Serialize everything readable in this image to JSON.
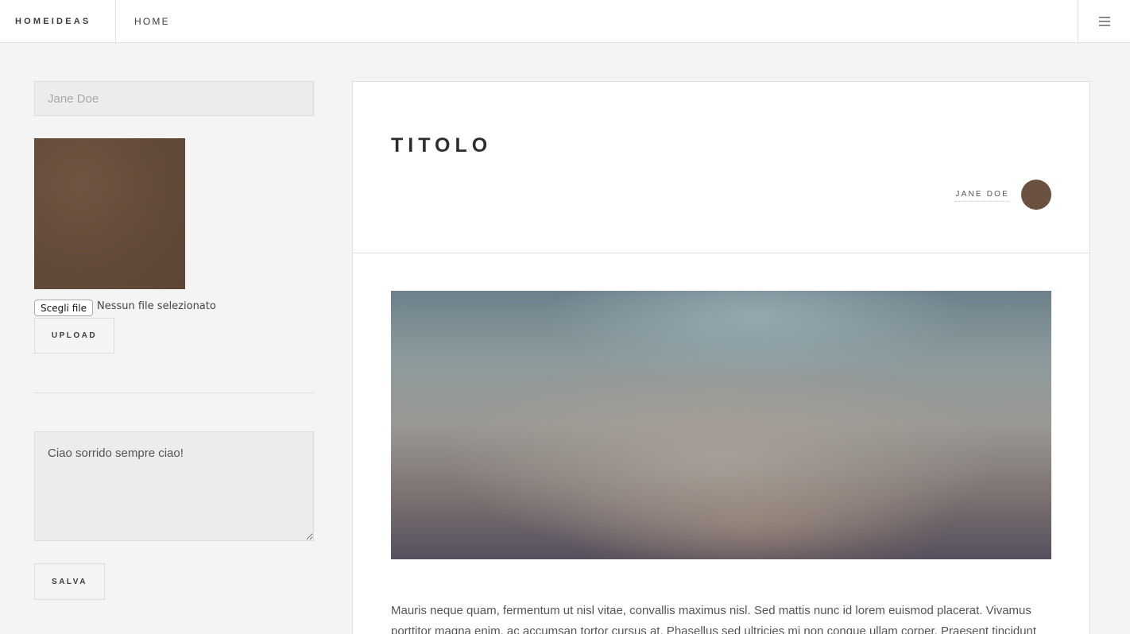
{
  "header": {
    "logo": "HOMEIDEAS",
    "nav_home": "HOME",
    "menu_icon": "hamburger-icon"
  },
  "sidebar": {
    "name_placeholder": "Jane Doe",
    "avatar_color": "#6b5140",
    "file_button": "Scegli file",
    "file_status": "Nessun file selezionato",
    "upload_label": "UPLOAD",
    "bio_text": "Ciao sorrido sempre ciao!",
    "save_label": "SALVA"
  },
  "article": {
    "title": "TITOLO",
    "author": "JANE DOE",
    "body": "Mauris neque quam, fermentum ut nisl vitae, convallis maximus nisl. Sed mattis nunc id lorem euismod placerat. Vivamus porttitor magna enim, ac accumsan tortor cursus at. Phasellus sed ultricies mi non congue ullam corper. Praesent tincidunt"
  }
}
